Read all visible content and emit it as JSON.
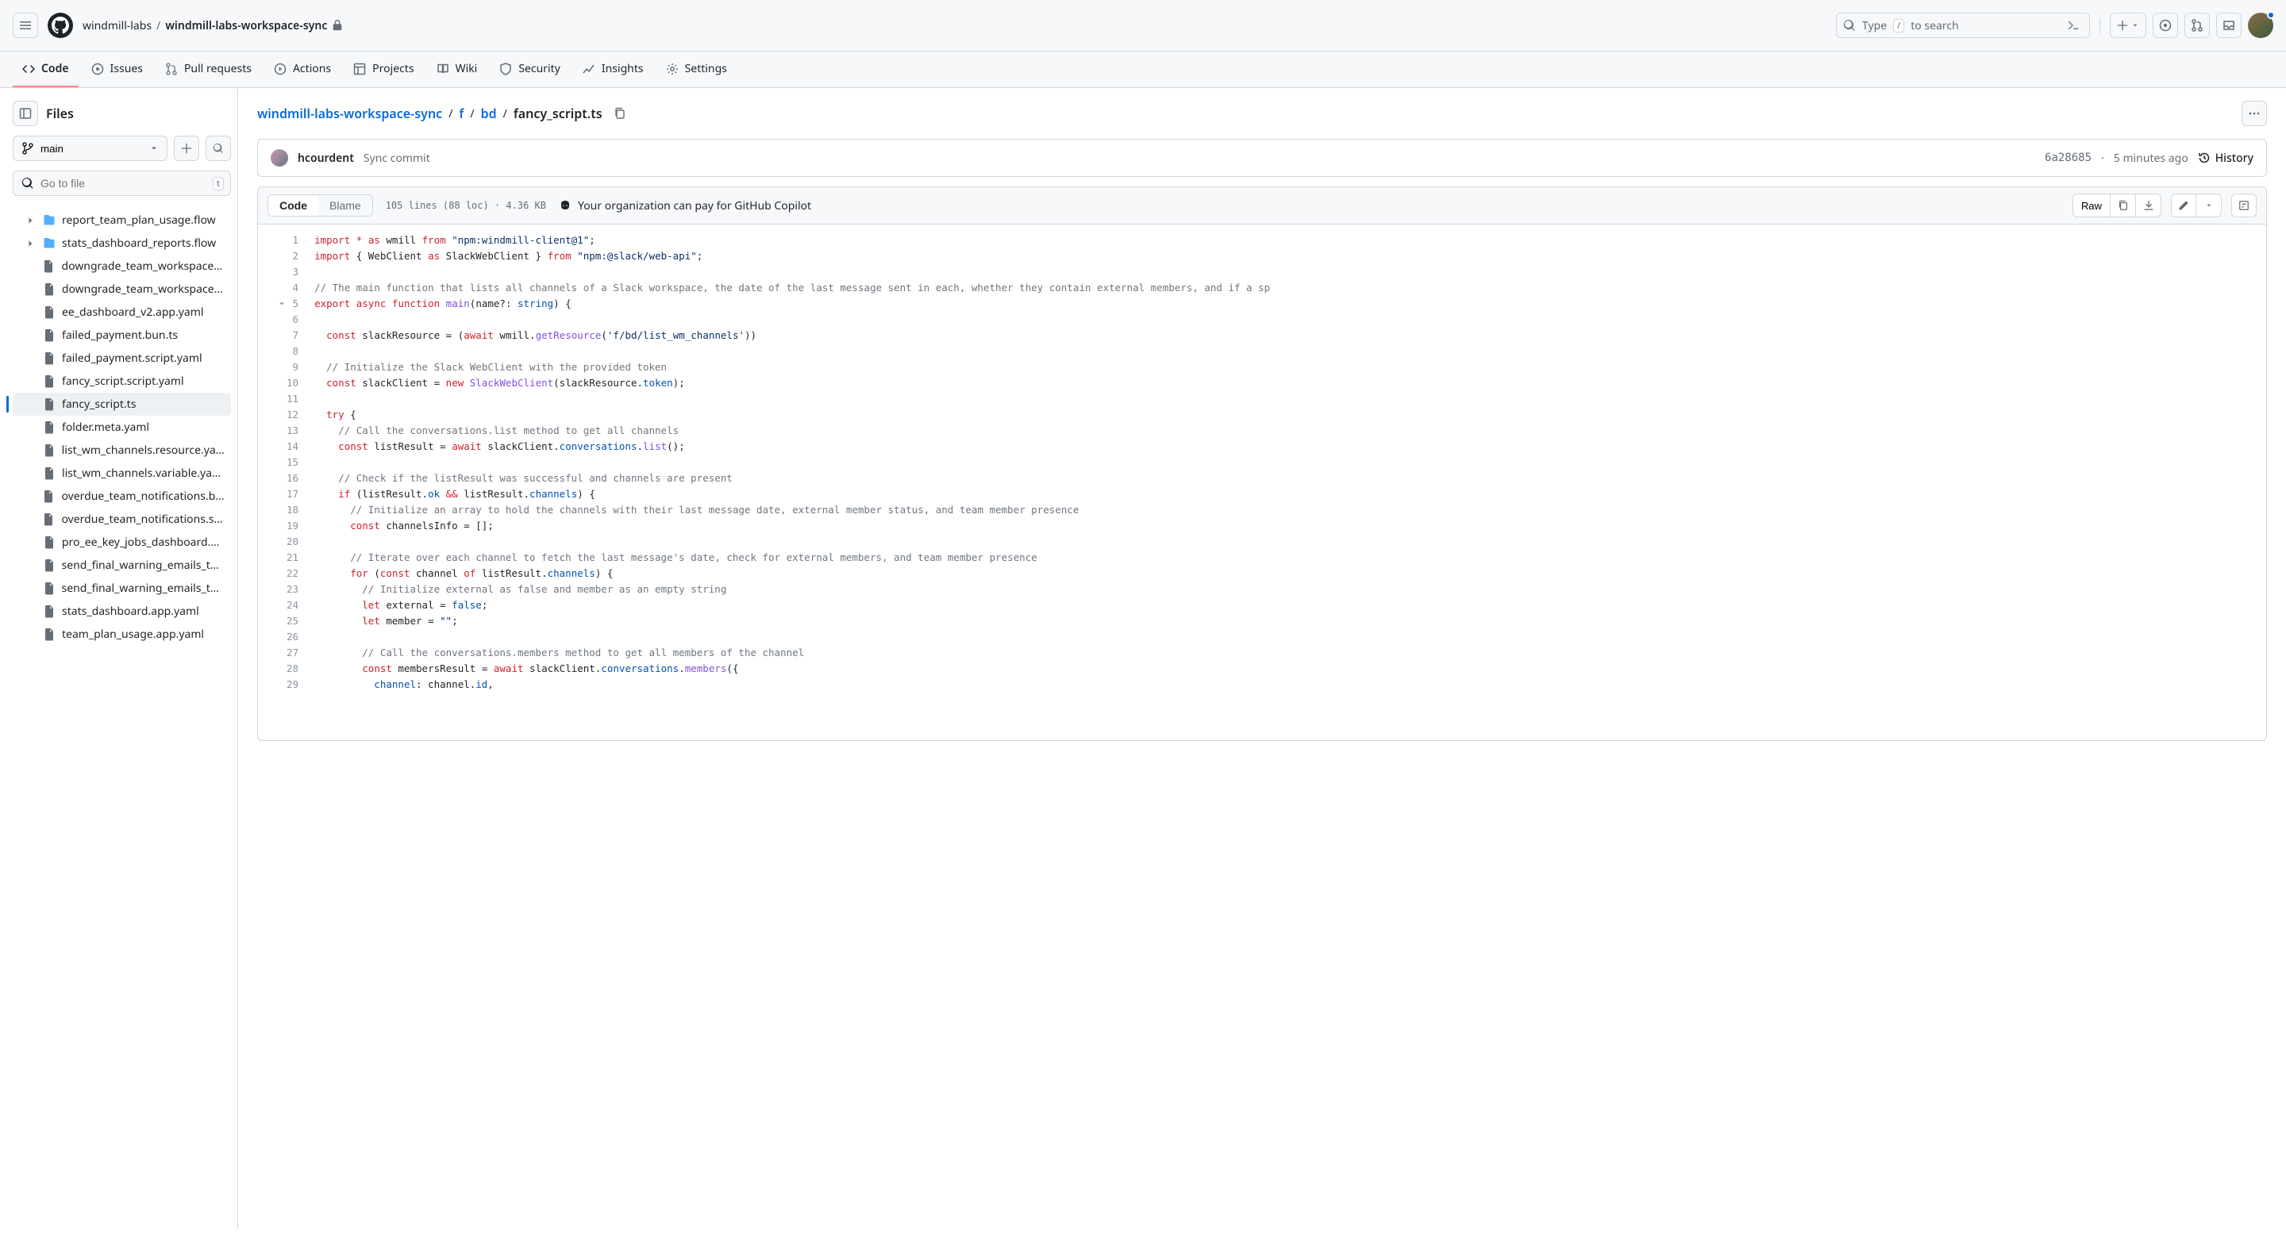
{
  "header": {
    "org": "windmill-labs",
    "repo": "windmill-labs-workspace-sync",
    "search_placeholder_pre": "Type",
    "search_kbd": "/",
    "search_placeholder_post": "to search"
  },
  "nav": {
    "code": "Code",
    "issues": "Issues",
    "pr": "Pull requests",
    "actions": "Actions",
    "projects": "Projects",
    "wiki": "Wiki",
    "security": "Security",
    "insights": "Insights",
    "settings": "Settings"
  },
  "sidebar": {
    "title": "Files",
    "branch": "main",
    "goto_placeholder": "Go to file",
    "goto_kbd": "t",
    "items": [
      {
        "name": "report_team_plan_usage.flow",
        "type": "folder",
        "expandable": true,
        "indent": 1
      },
      {
        "name": "stats_dashboard_reports.flow",
        "type": "folder",
        "expandable": true,
        "indent": 1
      },
      {
        "name": "downgrade_team_workspace.s…",
        "type": "file",
        "indent": 1
      },
      {
        "name": "downgrade_team_workspace.ts",
        "type": "file",
        "indent": 1
      },
      {
        "name": "ee_dashboard_v2.app.yaml",
        "type": "file",
        "indent": 1
      },
      {
        "name": "failed_payment.bun.ts",
        "type": "file",
        "indent": 1
      },
      {
        "name": "failed_payment.script.yaml",
        "type": "file",
        "indent": 1
      },
      {
        "name": "fancy_script.script.yaml",
        "type": "file",
        "indent": 1
      },
      {
        "name": "fancy_script.ts",
        "type": "file",
        "indent": 1,
        "selected": true
      },
      {
        "name": "folder.meta.yaml",
        "type": "file",
        "indent": 1
      },
      {
        "name": "list_wm_channels.resource.yaml",
        "type": "file",
        "indent": 1
      },
      {
        "name": "list_wm_channels.variable.yaml",
        "type": "file",
        "indent": 1
      },
      {
        "name": "overdue_team_notifications.bu…",
        "type": "file",
        "indent": 1
      },
      {
        "name": "overdue_team_notifications.scr…",
        "type": "file",
        "indent": 1
      },
      {
        "name": "pro_ee_key_jobs_dashboard.a…",
        "type": "file",
        "indent": 1
      },
      {
        "name": "send_final_warning_emails_to_…",
        "type": "file",
        "indent": 1
      },
      {
        "name": "send_final_warning_emails_to_…",
        "type": "file",
        "indent": 1
      },
      {
        "name": "stats_dashboard.app.yaml",
        "type": "file",
        "indent": 1
      },
      {
        "name": "team_plan_usage.app.yaml",
        "type": "file",
        "indent": 1
      }
    ]
  },
  "path": {
    "parts": [
      "windmill-labs-workspace-sync",
      "f",
      "bd"
    ],
    "file": "fancy_script.ts"
  },
  "commit": {
    "author": "hcourdent",
    "message": "Sync commit",
    "sha": "6a28685",
    "when": "5 minutes ago",
    "history": "History"
  },
  "toolbar": {
    "code": "Code",
    "blame": "Blame",
    "meta": "105 lines (88 loc) · 4.36 KB",
    "copilot": "Your organization can pay for GitHub Copilot",
    "raw": "Raw"
  },
  "code": {
    "lines": [
      {
        "n": 1,
        "html": "<span class='tok-kw'>import</span> <span class='tok-kw'>*</span> <span class='tok-kw'>as</span> wmill <span class='tok-kw'>from</span> <span class='tok-str'>\"npm:windmill-client@1\"</span>;"
      },
      {
        "n": 2,
        "html": "<span class='tok-kw'>import</span> { <span>WebClient</span> <span class='tok-kw'>as</span> <span>SlackWebClient</span> } <span class='tok-kw'>from</span> <span class='tok-str'>\"npm:@slack/web-api\"</span>;"
      },
      {
        "n": 3,
        "html": ""
      },
      {
        "n": 4,
        "html": "<span class='tok-com'>// The main function that lists all channels of a Slack workspace, the date of the last message sent in each, whether they contain external members, and if a sp</span>"
      },
      {
        "n": 5,
        "fold": true,
        "html": "<span class='tok-kw'>export</span> <span class='tok-kw'>async</span> <span class='tok-kw'>function</span> <span class='tok-fn'>main</span>(<span>name</span>?: <span class='tok-const'>string</span>) {"
      },
      {
        "n": 6,
        "html": ""
      },
      {
        "n": 7,
        "html": "  <span class='tok-kw'>const</span> <span>slackResource</span> = (<span class='tok-kw'>await</span> wmill.<span class='tok-fn'>getResource</span>(<span class='tok-str'>'f/bd/list_wm_channels'</span>))"
      },
      {
        "n": 8,
        "html": ""
      },
      {
        "n": 9,
        "html": "  <span class='tok-com'>// Initialize the Slack WebClient with the provided token</span>"
      },
      {
        "n": 10,
        "html": "  <span class='tok-kw'>const</span> <span>slackClient</span> = <span class='tok-kw'>new</span> <span class='tok-fn'>SlackWebClient</span>(slackResource.<span class='tok-prop'>token</span>);"
      },
      {
        "n": 11,
        "html": ""
      },
      {
        "n": 12,
        "html": "  <span class='tok-kw'>try</span> {"
      },
      {
        "n": 13,
        "html": "    <span class='tok-com'>// Call the conversations.list method to get all channels</span>"
      },
      {
        "n": 14,
        "html": "    <span class='tok-kw'>const</span> <span>listResult</span> = <span class='tok-kw'>await</span> slackClient.<span class='tok-prop'>conversations</span>.<span class='tok-fn'>list</span>();"
      },
      {
        "n": 15,
        "html": ""
      },
      {
        "n": 16,
        "html": "    <span class='tok-com'>// Check if the listResult was successful and channels are present</span>"
      },
      {
        "n": 17,
        "html": "    <span class='tok-kw'>if</span> (listResult.<span class='tok-prop'>ok</span> <span class='tok-kw'>&amp;&amp;</span> listResult.<span class='tok-prop'>channels</span>) {"
      },
      {
        "n": 18,
        "html": "      <span class='tok-com'>// Initialize an array to hold the channels with their last message date, external member status, and team member presence</span>"
      },
      {
        "n": 19,
        "html": "      <span class='tok-kw'>const</span> <span>channelsInfo</span> = [];"
      },
      {
        "n": 20,
        "html": ""
      },
      {
        "n": 21,
        "html": "      <span class='tok-com'>// Iterate over each channel to fetch the last message's date, check for external members, and team member presence</span>"
      },
      {
        "n": 22,
        "html": "      <span class='tok-kw'>for</span> (<span class='tok-kw'>const</span> channel <span class='tok-kw'>of</span> listResult.<span class='tok-prop'>channels</span>) {"
      },
      {
        "n": 23,
        "html": "        <span class='tok-com'>// Initialize external as false and member as an empty string</span>"
      },
      {
        "n": 24,
        "html": "        <span class='tok-kw'>let</span> external = <span class='tok-const'>false</span>;"
      },
      {
        "n": 25,
        "html": "        <span class='tok-kw'>let</span> member = <span class='tok-str'>\"\"</span>;"
      },
      {
        "n": 26,
        "html": ""
      },
      {
        "n": 27,
        "html": "        <span class='tok-com'>// Call the conversations.members method to get all members of the channel</span>"
      },
      {
        "n": 28,
        "html": "        <span class='tok-kw'>const</span> <span>membersResult</span> = <span class='tok-kw'>await</span> slackClient.<span class='tok-prop'>conversations</span>.<span class='tok-fn'>members</span>({"
      },
      {
        "n": 29,
        "html": "          <span class='tok-prop'>channel</span>: channel.<span class='tok-prop'>id</span>,"
      }
    ]
  }
}
